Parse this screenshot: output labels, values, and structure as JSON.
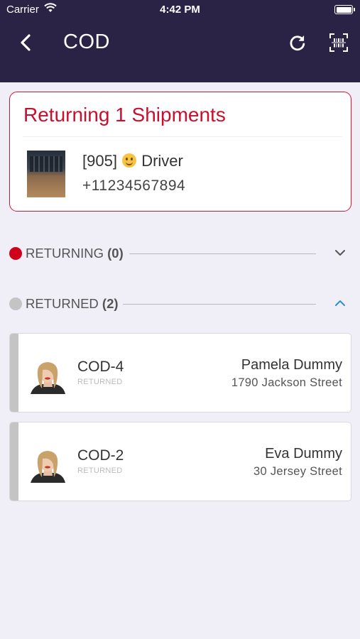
{
  "status_bar": {
    "carrier": "Carrier",
    "time": "4:42 PM"
  },
  "nav": {
    "title": "COD",
    "back_icon": "chevron-left-icon",
    "refresh_icon": "refresh-icon",
    "scan_icon": "barcode-scan-icon"
  },
  "summary": {
    "title": "Returning 1 Shipments",
    "driver": {
      "id_prefix": "[905]",
      "emoji": "slightly-smiling-face",
      "name": "Driver",
      "phone": "+11234567894"
    }
  },
  "sections": [
    {
      "label": "RETURNING",
      "count": "(0)",
      "dot_color": "#d0021b",
      "expanded": false,
      "chevron": "chevron-down-icon"
    },
    {
      "label": "RETURNED",
      "count": "(2)",
      "dot_color": "#c4c4c4",
      "expanded": true,
      "chevron": "chevron-up-icon"
    }
  ],
  "shipments": [
    {
      "code": "COD-4",
      "status": "RETURNED",
      "customer": "Pamela Dummy",
      "address": "1790 Jackson Street"
    },
    {
      "code": "COD-2",
      "status": "RETURNED",
      "customer": "Eva Dummy",
      "address": "30 Jersey Street"
    }
  ],
  "colors": {
    "nav_bg": "#2a2346",
    "accent_red": "#c8102e",
    "chevron_blue": "#2b8fd6",
    "page_bg": "#f0eff7"
  }
}
